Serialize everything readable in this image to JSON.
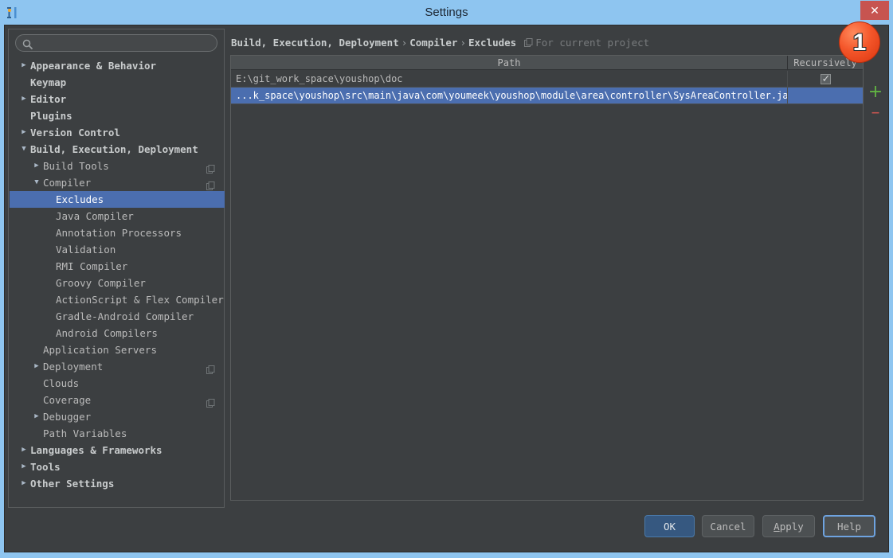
{
  "window": {
    "title": "Settings",
    "app_icon": "intellij-idea-icon",
    "close_label": "✕"
  },
  "search": {
    "value": "",
    "placeholder": "",
    "icon": "search-icon"
  },
  "sidebar": {
    "items": [
      {
        "label": "Appearance & Behavior",
        "indent": 0,
        "arrow": "▶",
        "bold": true,
        "selected": false,
        "copy_icon": false
      },
      {
        "label": "Keymap",
        "indent": 0,
        "arrow": "",
        "bold": true,
        "selected": false,
        "copy_icon": false
      },
      {
        "label": "Editor",
        "indent": 0,
        "arrow": "▶",
        "bold": true,
        "selected": false,
        "copy_icon": false
      },
      {
        "label": "Plugins",
        "indent": 0,
        "arrow": "",
        "bold": true,
        "selected": false,
        "copy_icon": false
      },
      {
        "label": "Version Control",
        "indent": 0,
        "arrow": "▶",
        "bold": true,
        "selected": false,
        "copy_icon": false
      },
      {
        "label": "Build, Execution, Deployment",
        "indent": 0,
        "arrow": "▼",
        "bold": true,
        "selected": false,
        "copy_icon": false
      },
      {
        "label": "Build Tools",
        "indent": 1,
        "arrow": "▶",
        "bold": false,
        "selected": false,
        "copy_icon": true
      },
      {
        "label": "Compiler",
        "indent": 1,
        "arrow": "▼",
        "bold": false,
        "selected": false,
        "copy_icon": true
      },
      {
        "label": "Excludes",
        "indent": 2,
        "arrow": "",
        "bold": false,
        "selected": true,
        "copy_icon": false
      },
      {
        "label": "Java Compiler",
        "indent": 2,
        "arrow": "",
        "bold": false,
        "selected": false,
        "copy_icon": false
      },
      {
        "label": "Annotation Processors",
        "indent": 2,
        "arrow": "",
        "bold": false,
        "selected": false,
        "copy_icon": false
      },
      {
        "label": "Validation",
        "indent": 2,
        "arrow": "",
        "bold": false,
        "selected": false,
        "copy_icon": false
      },
      {
        "label": "RMI Compiler",
        "indent": 2,
        "arrow": "",
        "bold": false,
        "selected": false,
        "copy_icon": false
      },
      {
        "label": "Groovy Compiler",
        "indent": 2,
        "arrow": "",
        "bold": false,
        "selected": false,
        "copy_icon": false
      },
      {
        "label": "ActionScript & Flex Compiler",
        "indent": 2,
        "arrow": "",
        "bold": false,
        "selected": false,
        "copy_icon": false
      },
      {
        "label": "Gradle-Android Compiler",
        "indent": 2,
        "arrow": "",
        "bold": false,
        "selected": false,
        "copy_icon": false
      },
      {
        "label": "Android Compilers",
        "indent": 2,
        "arrow": "",
        "bold": false,
        "selected": false,
        "copy_icon": false
      },
      {
        "label": "Application Servers",
        "indent": 1,
        "arrow": "",
        "bold": false,
        "selected": false,
        "copy_icon": false
      },
      {
        "label": "Deployment",
        "indent": 1,
        "arrow": "▶",
        "bold": false,
        "selected": false,
        "copy_icon": true
      },
      {
        "label": "Clouds",
        "indent": 1,
        "arrow": "",
        "bold": false,
        "selected": false,
        "copy_icon": false
      },
      {
        "label": "Coverage",
        "indent": 1,
        "arrow": "",
        "bold": false,
        "selected": false,
        "copy_icon": true
      },
      {
        "label": "Debugger",
        "indent": 1,
        "arrow": "▶",
        "bold": false,
        "selected": false,
        "copy_icon": false
      },
      {
        "label": "Path Variables",
        "indent": 1,
        "arrow": "",
        "bold": false,
        "selected": false,
        "copy_icon": false
      },
      {
        "label": "Languages & Frameworks",
        "indent": 0,
        "arrow": "▶",
        "bold": true,
        "selected": false,
        "copy_icon": false
      },
      {
        "label": "Tools",
        "indent": 0,
        "arrow": "▶",
        "bold": true,
        "selected": false,
        "copy_icon": false
      },
      {
        "label": "Other Settings",
        "indent": 0,
        "arrow": "▶",
        "bold": true,
        "selected": false,
        "copy_icon": false
      }
    ]
  },
  "breadcrumb": {
    "crumbs": [
      "Build, Execution, Deployment",
      "Compiler",
      "Excludes"
    ],
    "separator": "›",
    "scope_label": "For current project",
    "scope_icon": "project-scope-icon"
  },
  "table": {
    "columns": [
      "Path",
      "Recursively"
    ],
    "rows": [
      {
        "path": "E:\\git_work_space\\youshop\\doc",
        "recursively": true,
        "selected": false
      },
      {
        "path": "...k_space\\youshop\\src\\main\\java\\com\\youmeek\\youshop\\module\\area\\controller\\SysAreaController.java",
        "recursively": false,
        "selected": true
      }
    ]
  },
  "toolbar": {
    "add_label": "+",
    "remove_label": "–"
  },
  "badge": {
    "number": "1"
  },
  "buttons": {
    "ok": "OK",
    "cancel": "Cancel",
    "apply_prefix": "A",
    "apply_rest": "pply",
    "help": "Help"
  },
  "colors": {
    "titlebar": "#8ec5f0",
    "dialog_bg": "#3c3f41",
    "selection": "#4b6eaf",
    "header_bg": "#4c5052",
    "accent_green": "#62b543",
    "accent_red": "#c75450",
    "default_button": "#365880",
    "badge_red": "#f4562a"
  }
}
